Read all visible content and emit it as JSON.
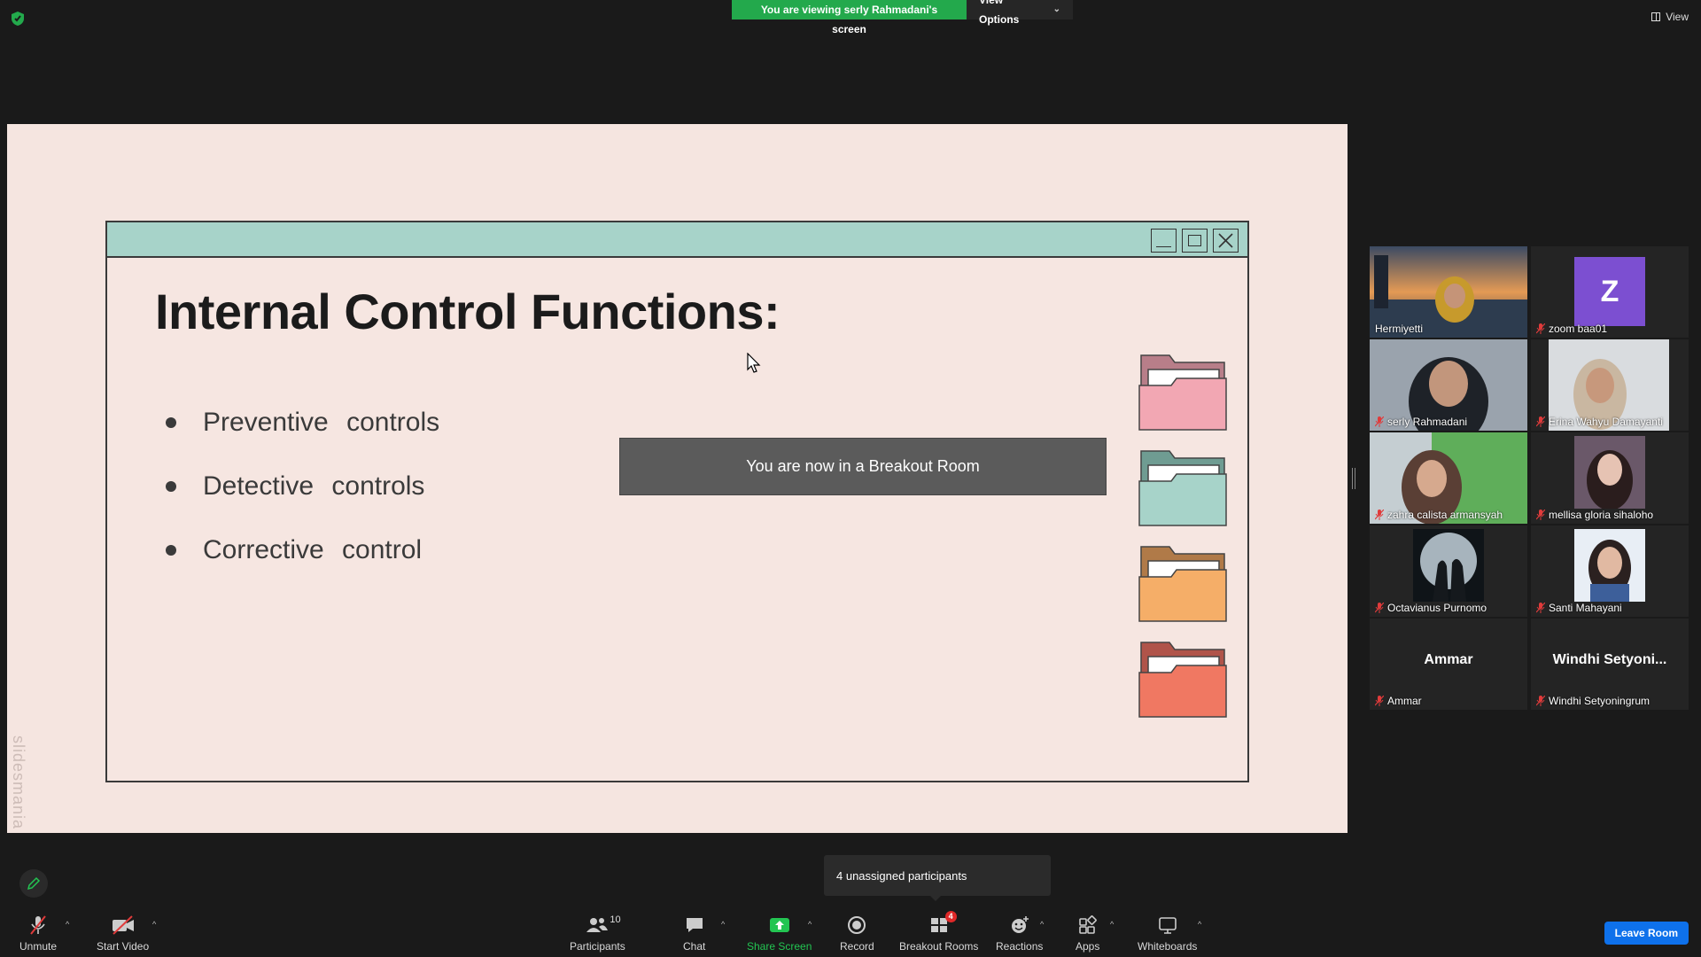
{
  "top": {
    "viewing_text": "You are viewing serly Rahmadani's screen",
    "view_options_label": "View Options",
    "view_label": "View"
  },
  "slide": {
    "title": "Internal Control Functions:",
    "bullets": [
      "Preventive   controls",
      "Detective   controls",
      "Corrective   control"
    ],
    "watermark": "slidesmania",
    "folder_colors": [
      "#f2a7b3",
      "#a7d3c9",
      "#f5ae68",
      "#f07862"
    ]
  },
  "breakout_toast": "You are now in a Breakout Room",
  "participants": [
    {
      "name": "Hermiyetti",
      "muted": false,
      "active": true
    },
    {
      "name": "zoom baa01",
      "muted": true,
      "avatar_letter": "Z"
    },
    {
      "name": "serly Rahmadani",
      "muted": true
    },
    {
      "name": "Erina Wahyu Damayanti",
      "muted": true
    },
    {
      "name": "zahra calista armansyah",
      "muted": true
    },
    {
      "name": "mellisa gloria sihaloho",
      "muted": true
    },
    {
      "name": "Octavianus Purnomo",
      "muted": true
    },
    {
      "name": "Santi Mahayani",
      "muted": true
    },
    {
      "name": "Ammar",
      "muted": true,
      "display_name": "Ammar"
    },
    {
      "name": "Windhi Setyoningrum",
      "muted": true,
      "display_name": "Windhi  Setyoni..."
    }
  ],
  "unassigned_text": "4 unassigned participants",
  "toolbar": {
    "unmute": "Unmute",
    "start_video": "Start Video",
    "participants": "Participants",
    "participants_count": "10",
    "chat": "Chat",
    "share_screen": "Share Screen",
    "record": "Record",
    "breakout_rooms": "Breakout Rooms",
    "breakout_badge": "4",
    "reactions": "Reactions",
    "apps": "Apps",
    "whiteboards": "Whiteboards",
    "leave_room": "Leave Room"
  },
  "colors": {
    "accent_green": "#23a94c",
    "leave_blue": "#0e71eb",
    "active_outline": "#d7e84a"
  }
}
